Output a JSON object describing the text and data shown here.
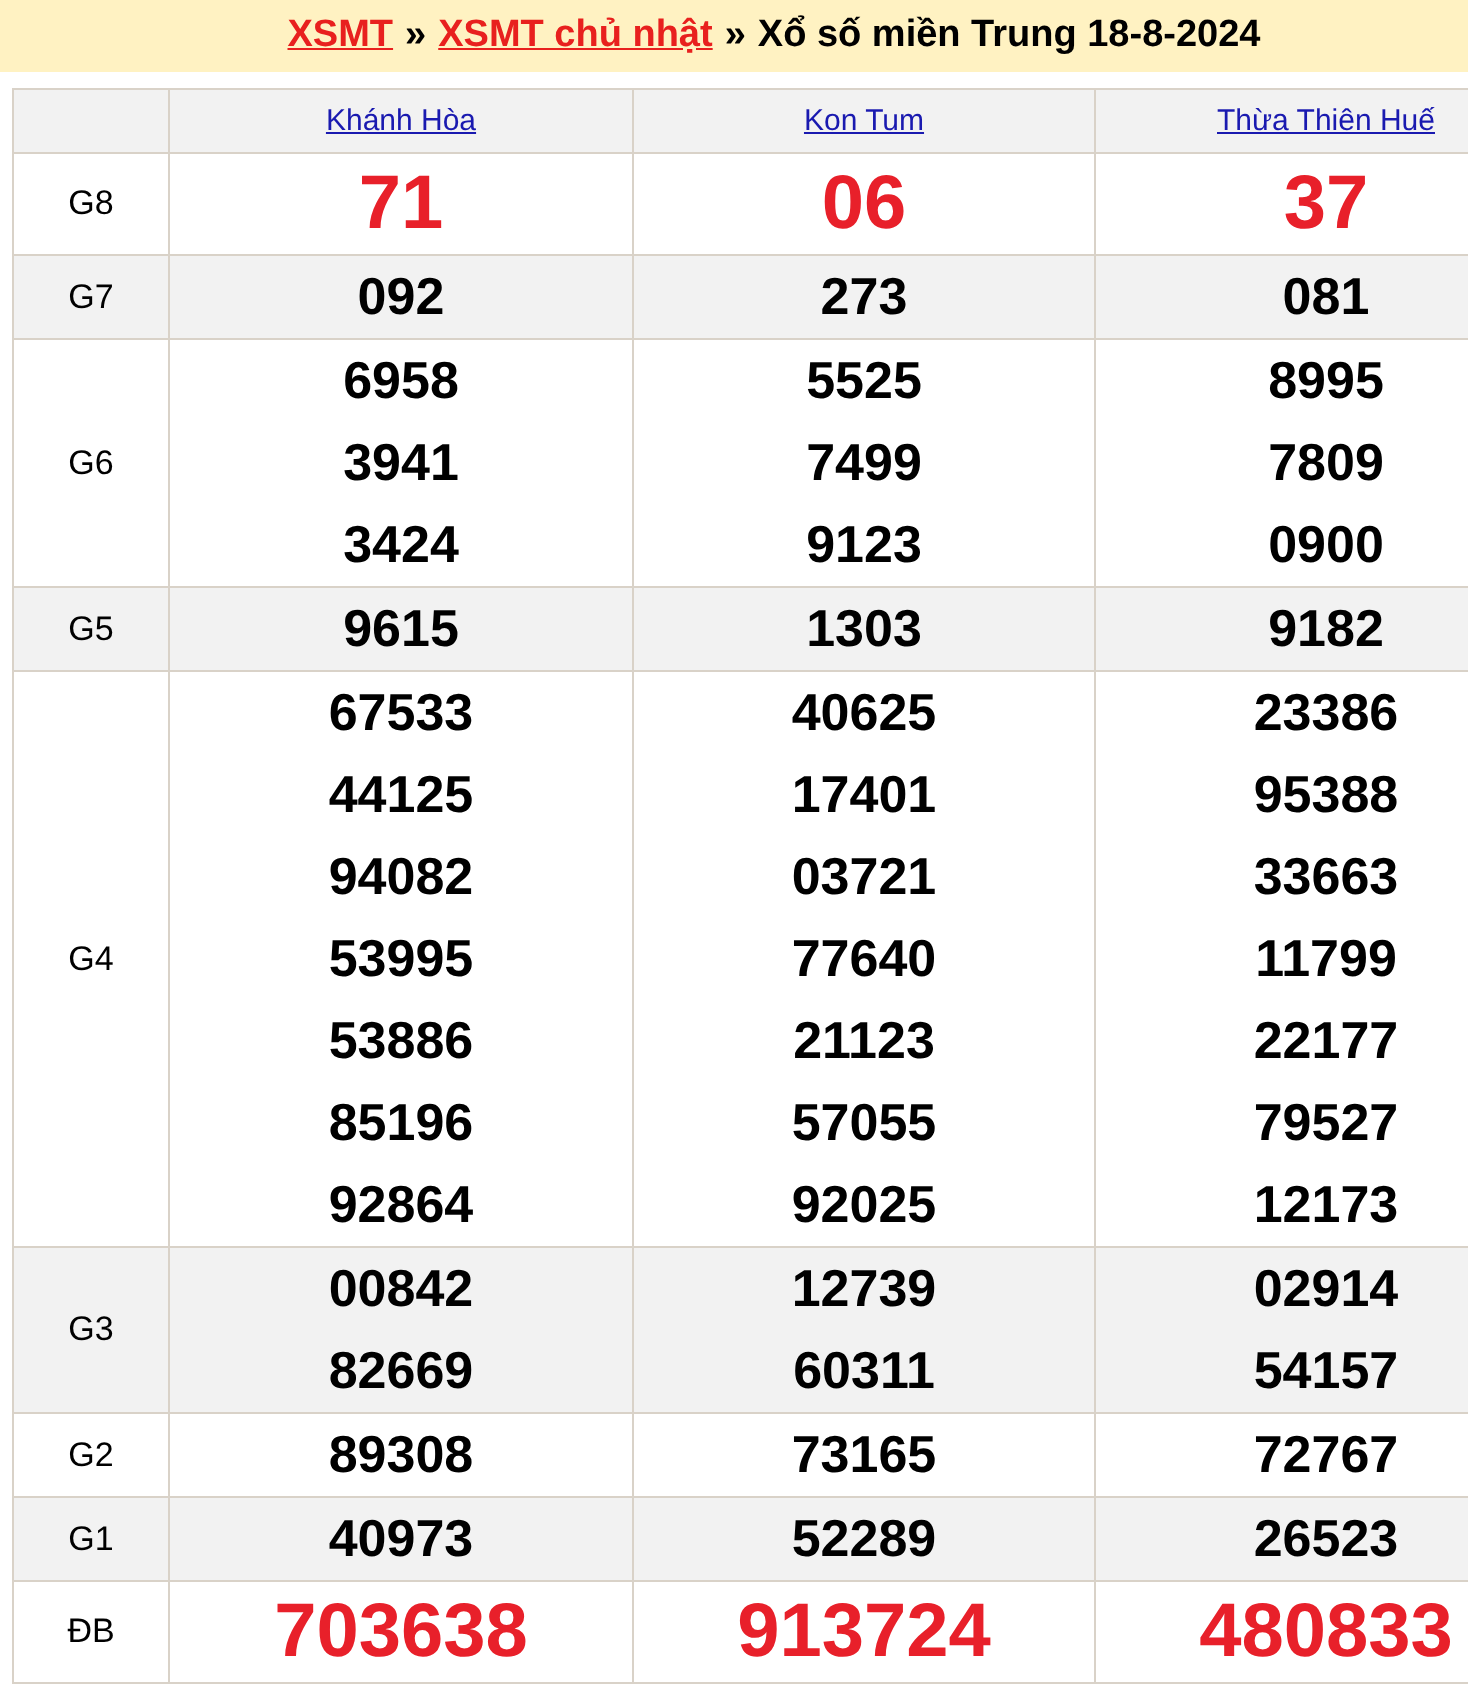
{
  "breadcrumb": [
    {
      "kind": "link",
      "text": "XSMT"
    },
    {
      "kind": "text",
      "text": "»"
    },
    {
      "kind": "link",
      "text": "XSMT chủ nhật"
    },
    {
      "kind": "text",
      "text": "»"
    },
    {
      "kind": "text",
      "text": "Xổ số miền Trung 18-8-2024"
    }
  ],
  "provinces": [
    "Khánh Hòa",
    "Kon Tum",
    "Thừa Thiên Huế"
  ],
  "rows": [
    {
      "label": "G8",
      "kind": "red",
      "cells": [
        [
          "71"
        ],
        [
          "06"
        ],
        [
          "37"
        ]
      ]
    },
    {
      "label": "G7",
      "kind": "normal",
      "cells": [
        [
          "092"
        ],
        [
          "273"
        ],
        [
          "081"
        ]
      ]
    },
    {
      "label": "G6",
      "kind": "normal",
      "cells": [
        [
          "6958",
          "3941",
          "3424"
        ],
        [
          "5525",
          "7499",
          "9123"
        ],
        [
          "8995",
          "7809",
          "0900"
        ]
      ]
    },
    {
      "label": "G5",
      "kind": "normal",
      "cells": [
        [
          "9615"
        ],
        [
          "1303"
        ],
        [
          "9182"
        ]
      ]
    },
    {
      "label": "G4",
      "kind": "normal",
      "cells": [
        [
          "67533",
          "44125",
          "94082",
          "53995",
          "53886",
          "85196",
          "92864"
        ],
        [
          "40625",
          "17401",
          "03721",
          "77640",
          "21123",
          "57055",
          "92025"
        ],
        [
          "23386",
          "95388",
          "33663",
          "11799",
          "22177",
          "79527",
          "12173"
        ]
      ]
    },
    {
      "label": "G3",
      "kind": "normal",
      "cells": [
        [
          "00842",
          "82669"
        ],
        [
          "12739",
          "60311"
        ],
        [
          "02914",
          "54157"
        ]
      ]
    },
    {
      "label": "G2",
      "kind": "normal",
      "cells": [
        [
          "89308"
        ],
        [
          "73165"
        ],
        [
          "72767"
        ]
      ]
    },
    {
      "label": "G1",
      "kind": "normal",
      "cells": [
        [
          "40973"
        ],
        [
          "52289"
        ],
        [
          "26523"
        ]
      ]
    },
    {
      "label": "ĐB",
      "kind": "red",
      "cells": [
        [
          "703638"
        ],
        [
          "913724"
        ],
        [
          "480833"
        ]
      ]
    }
  ]
}
